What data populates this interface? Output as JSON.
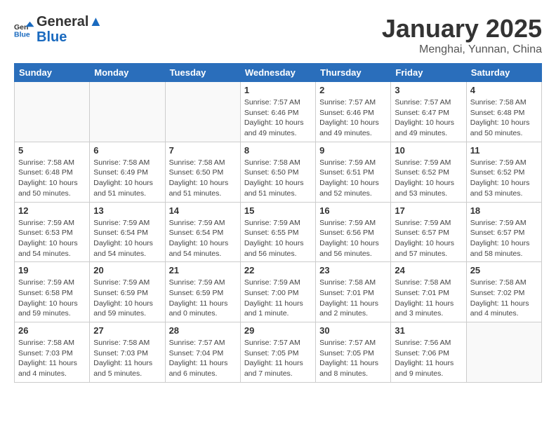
{
  "header": {
    "logo_line1": "General",
    "logo_line2": "Blue",
    "month": "January 2025",
    "location": "Menghai, Yunnan, China"
  },
  "days_of_week": [
    "Sunday",
    "Monday",
    "Tuesday",
    "Wednesday",
    "Thursday",
    "Friday",
    "Saturday"
  ],
  "weeks": [
    [
      {
        "day": "",
        "info": ""
      },
      {
        "day": "",
        "info": ""
      },
      {
        "day": "",
        "info": ""
      },
      {
        "day": "1",
        "info": "Sunrise: 7:57 AM\nSunset: 6:46 PM\nDaylight: 10 hours\nand 49 minutes."
      },
      {
        "day": "2",
        "info": "Sunrise: 7:57 AM\nSunset: 6:46 PM\nDaylight: 10 hours\nand 49 minutes."
      },
      {
        "day": "3",
        "info": "Sunrise: 7:57 AM\nSunset: 6:47 PM\nDaylight: 10 hours\nand 49 minutes."
      },
      {
        "day": "4",
        "info": "Sunrise: 7:58 AM\nSunset: 6:48 PM\nDaylight: 10 hours\nand 50 minutes."
      }
    ],
    [
      {
        "day": "5",
        "info": "Sunrise: 7:58 AM\nSunset: 6:48 PM\nDaylight: 10 hours\nand 50 minutes."
      },
      {
        "day": "6",
        "info": "Sunrise: 7:58 AM\nSunset: 6:49 PM\nDaylight: 10 hours\nand 51 minutes."
      },
      {
        "day": "7",
        "info": "Sunrise: 7:58 AM\nSunset: 6:50 PM\nDaylight: 10 hours\nand 51 minutes."
      },
      {
        "day": "8",
        "info": "Sunrise: 7:58 AM\nSunset: 6:50 PM\nDaylight: 10 hours\nand 51 minutes."
      },
      {
        "day": "9",
        "info": "Sunrise: 7:59 AM\nSunset: 6:51 PM\nDaylight: 10 hours\nand 52 minutes."
      },
      {
        "day": "10",
        "info": "Sunrise: 7:59 AM\nSunset: 6:52 PM\nDaylight: 10 hours\nand 53 minutes."
      },
      {
        "day": "11",
        "info": "Sunrise: 7:59 AM\nSunset: 6:52 PM\nDaylight: 10 hours\nand 53 minutes."
      }
    ],
    [
      {
        "day": "12",
        "info": "Sunrise: 7:59 AM\nSunset: 6:53 PM\nDaylight: 10 hours\nand 54 minutes."
      },
      {
        "day": "13",
        "info": "Sunrise: 7:59 AM\nSunset: 6:54 PM\nDaylight: 10 hours\nand 54 minutes."
      },
      {
        "day": "14",
        "info": "Sunrise: 7:59 AM\nSunset: 6:54 PM\nDaylight: 10 hours\nand 54 minutes."
      },
      {
        "day": "15",
        "info": "Sunrise: 7:59 AM\nSunset: 6:55 PM\nDaylight: 10 hours\nand 56 minutes."
      },
      {
        "day": "16",
        "info": "Sunrise: 7:59 AM\nSunset: 6:56 PM\nDaylight: 10 hours\nand 56 minutes."
      },
      {
        "day": "17",
        "info": "Sunrise: 7:59 AM\nSunset: 6:57 PM\nDaylight: 10 hours\nand 57 minutes."
      },
      {
        "day": "18",
        "info": "Sunrise: 7:59 AM\nSunset: 6:57 PM\nDaylight: 10 hours\nand 58 minutes."
      }
    ],
    [
      {
        "day": "19",
        "info": "Sunrise: 7:59 AM\nSunset: 6:58 PM\nDaylight: 10 hours\nand 59 minutes."
      },
      {
        "day": "20",
        "info": "Sunrise: 7:59 AM\nSunset: 6:59 PM\nDaylight: 10 hours\nand 59 minutes."
      },
      {
        "day": "21",
        "info": "Sunrise: 7:59 AM\nSunset: 6:59 PM\nDaylight: 11 hours\nand 0 minutes."
      },
      {
        "day": "22",
        "info": "Sunrise: 7:59 AM\nSunset: 7:00 PM\nDaylight: 11 hours\nand 1 minute."
      },
      {
        "day": "23",
        "info": "Sunrise: 7:58 AM\nSunset: 7:01 PM\nDaylight: 11 hours\nand 2 minutes."
      },
      {
        "day": "24",
        "info": "Sunrise: 7:58 AM\nSunset: 7:01 PM\nDaylight: 11 hours\nand 3 minutes."
      },
      {
        "day": "25",
        "info": "Sunrise: 7:58 AM\nSunset: 7:02 PM\nDaylight: 11 hours\nand 4 minutes."
      }
    ],
    [
      {
        "day": "26",
        "info": "Sunrise: 7:58 AM\nSunset: 7:03 PM\nDaylight: 11 hours\nand 4 minutes."
      },
      {
        "day": "27",
        "info": "Sunrise: 7:58 AM\nSunset: 7:03 PM\nDaylight: 11 hours\nand 5 minutes."
      },
      {
        "day": "28",
        "info": "Sunrise: 7:57 AM\nSunset: 7:04 PM\nDaylight: 11 hours\nand 6 minutes."
      },
      {
        "day": "29",
        "info": "Sunrise: 7:57 AM\nSunset: 7:05 PM\nDaylight: 11 hours\nand 7 minutes."
      },
      {
        "day": "30",
        "info": "Sunrise: 7:57 AM\nSunset: 7:05 PM\nDaylight: 11 hours\nand 8 minutes."
      },
      {
        "day": "31",
        "info": "Sunrise: 7:56 AM\nSunset: 7:06 PM\nDaylight: 11 hours\nand 9 minutes."
      },
      {
        "day": "",
        "info": ""
      }
    ]
  ]
}
